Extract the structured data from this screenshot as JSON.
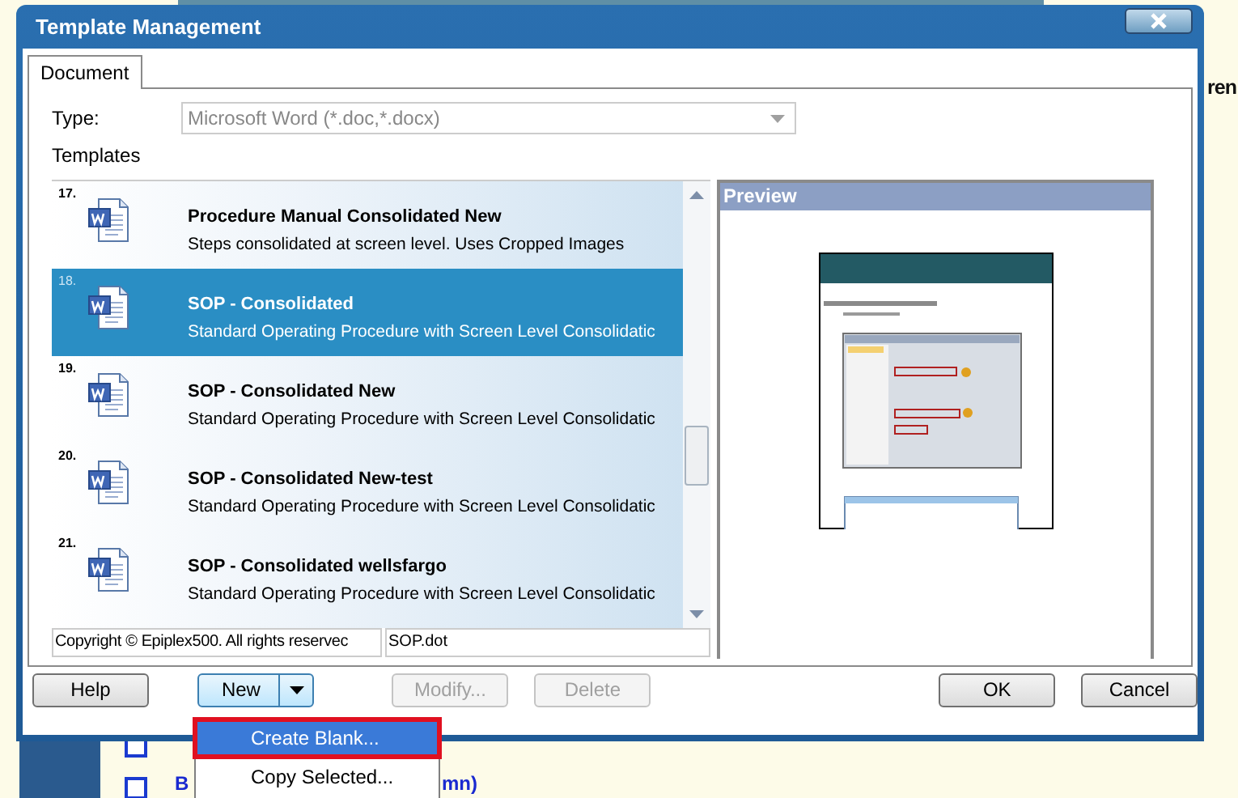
{
  "background": {
    "side_text": "ren",
    "checkboxes": [
      {
        "checked": false
      },
      {
        "checked": false
      }
    ],
    "bottom_texts": [
      "B",
      "mn)"
    ]
  },
  "window": {
    "title": "Template Management"
  },
  "tabs": [
    {
      "label": "Document",
      "selected": true
    }
  ],
  "type": {
    "label": "Type:",
    "value": "Microsoft Word (*.doc,*.docx)",
    "disabled": true
  },
  "templates": {
    "label": "Templates",
    "items": [
      {
        "number": "17.",
        "name": "Procedure Manual Consolidated New",
        "description": "Steps consolidated at screen level. Uses Cropped Images",
        "selected": false
      },
      {
        "number": "18.",
        "name": "SOP - Consolidated",
        "description": "Standard Operating Procedure with Screen Level Consolidatic",
        "selected": true
      },
      {
        "number": "19.",
        "name": "SOP - Consolidated New",
        "description": "Standard Operating Procedure with Screen Level Consolidatic",
        "selected": false
      },
      {
        "number": "20.",
        "name": "SOP - Consolidated New-test",
        "description": "Standard Operating Procedure with Screen Level Consolidatic",
        "selected": false
      },
      {
        "number": "21.",
        "name": "SOP - Consolidated wellsfargo",
        "description": "Standard Operating Procedure with Screen Level Consolidatic",
        "selected": false
      }
    ],
    "copyright": "Copyright © Epiplex500. All rights reservec",
    "file": "SOP.dot"
  },
  "preview": {
    "title": "Preview",
    "kind": "picture"
  },
  "buttons": [
    {
      "label": "Help",
      "kind": "plain",
      "disabled": false
    },
    {
      "label": "New",
      "kind": "split",
      "disabled": false
    },
    {
      "label": "Modify...",
      "kind": "plain",
      "disabled": true
    },
    {
      "label": "Delete",
      "kind": "plain",
      "disabled": true
    },
    {
      "label": "OK",
      "kind": "plain",
      "disabled": false
    },
    {
      "label": "Cancel",
      "kind": "plain",
      "disabled": false
    }
  ],
  "menu": [
    {
      "label": "Create Blank...",
      "selected": true
    },
    {
      "label": "Copy Selected...",
      "selected": false
    }
  ]
}
